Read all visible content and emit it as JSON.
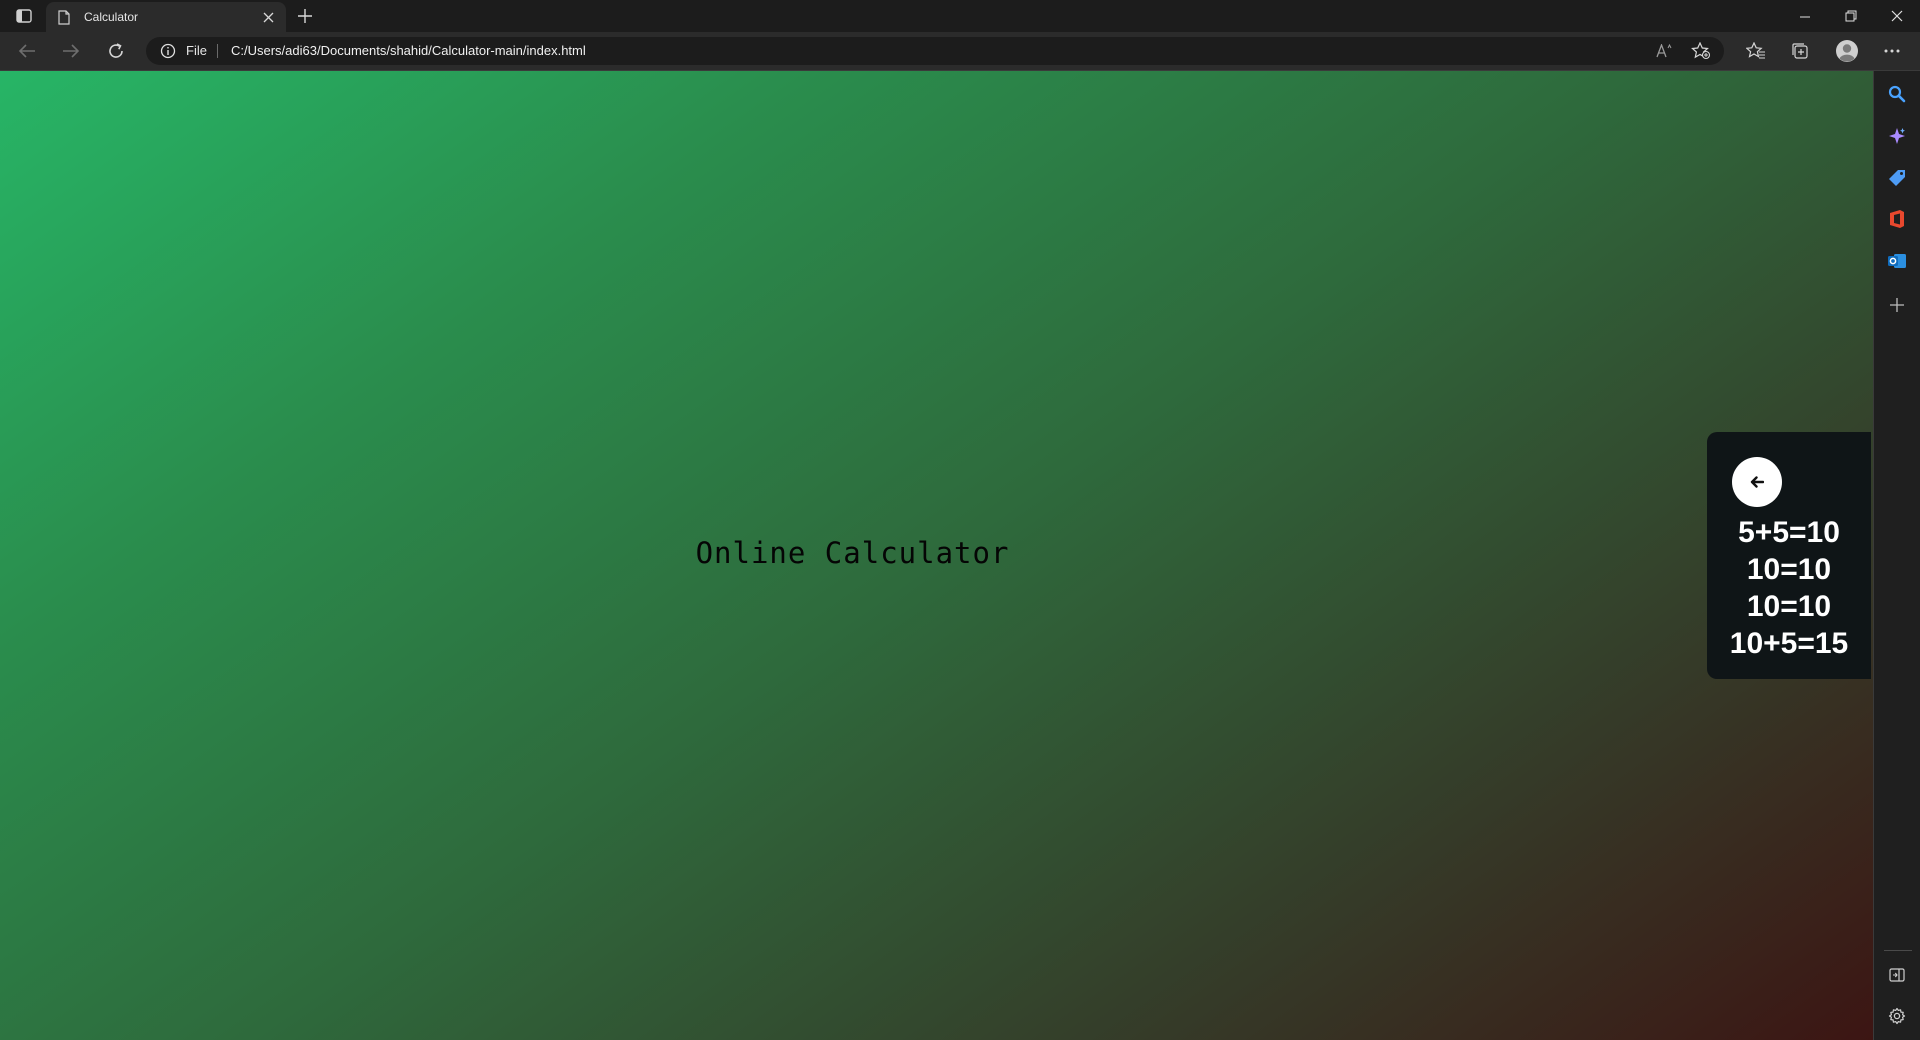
{
  "tab": {
    "title": "Calculator"
  },
  "address_bar": {
    "scheme_label": "File",
    "url": "C:/Users/adi63/Documents/shahid/Calculator-main/index.html"
  },
  "page": {
    "title": "Online Calculator",
    "history": [
      "5+5=10",
      "10=10",
      "10=10",
      "10+5=15"
    ]
  },
  "colors": {
    "gradient_start": "#27b566",
    "gradient_end": "#3c1513",
    "history_panel_bg": "#0f1517"
  },
  "icons": {
    "tab_actions": "tab-actions-icon",
    "favicon": "page-icon",
    "close": "close-icon",
    "new_tab": "plus-icon",
    "back": "back-arrow-icon",
    "forward": "forward-arrow-icon",
    "refresh": "refresh-icon",
    "info": "info-icon",
    "read_aloud": "read-aloud-icon",
    "favorite": "add-favorite-icon",
    "favorites": "favorites-icon",
    "collections": "collections-icon",
    "profile": "profile-avatar-icon",
    "more": "more-icon",
    "sidebar": [
      "search-icon",
      "copilot-icon",
      "shopping-icon",
      "office-icon",
      "outlook-icon",
      "add-icon"
    ],
    "sidebar_bottom": [
      "hide-sidebar-icon",
      "settings-icon"
    ]
  }
}
